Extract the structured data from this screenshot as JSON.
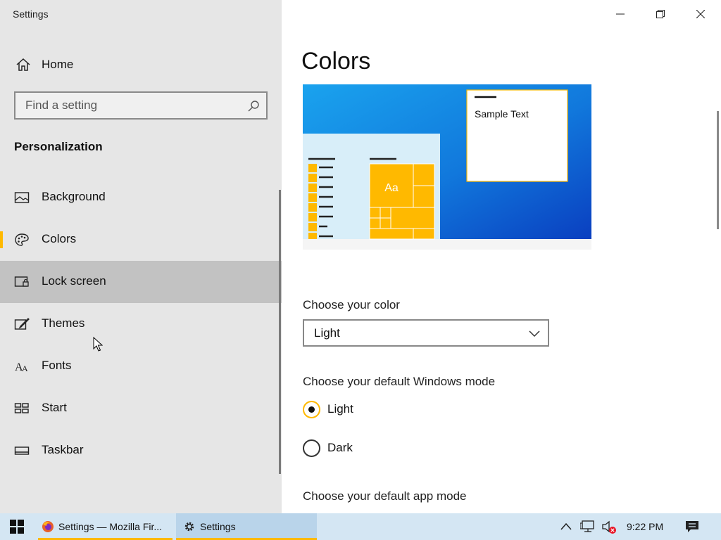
{
  "window": {
    "title": "Settings"
  },
  "sidebar": {
    "home_label": "Home",
    "search_placeholder": "Find a setting",
    "section_title": "Personalization",
    "items": [
      {
        "label": "Background",
        "icon": "picture-icon"
      },
      {
        "label": "Colors",
        "icon": "palette-icon",
        "selected": true
      },
      {
        "label": "Lock screen",
        "icon": "lock-screen-icon",
        "hovered": true
      },
      {
        "label": "Themes",
        "icon": "themes-icon"
      },
      {
        "label": "Fonts",
        "icon": "fonts-icon"
      },
      {
        "label": "Start",
        "icon": "start-icon"
      },
      {
        "label": "Taskbar",
        "icon": "taskbar-icon"
      }
    ]
  },
  "main": {
    "title": "Colors",
    "preview": {
      "sample_text": "Sample Text",
      "tile_text": "Aa"
    },
    "choose_color_label": "Choose your color",
    "choose_color_value": "Light",
    "windows_mode_label": "Choose your default Windows mode",
    "windows_mode_options": [
      {
        "label": "Light",
        "checked": true
      },
      {
        "label": "Dark",
        "checked": false
      }
    ],
    "app_mode_label": "Choose your default app mode"
  },
  "taskbar": {
    "buttons": [
      {
        "label": "Settings — Mozilla Fir...",
        "icon": "firefox-icon"
      },
      {
        "label": "Settings",
        "icon": "gear-icon",
        "active": true
      }
    ],
    "clock": "9:22 PM"
  },
  "colors": {
    "accent": "#ffb900",
    "sidebar_bg": "#e6e6e6",
    "taskbar_bg": "#d4e6f3"
  }
}
